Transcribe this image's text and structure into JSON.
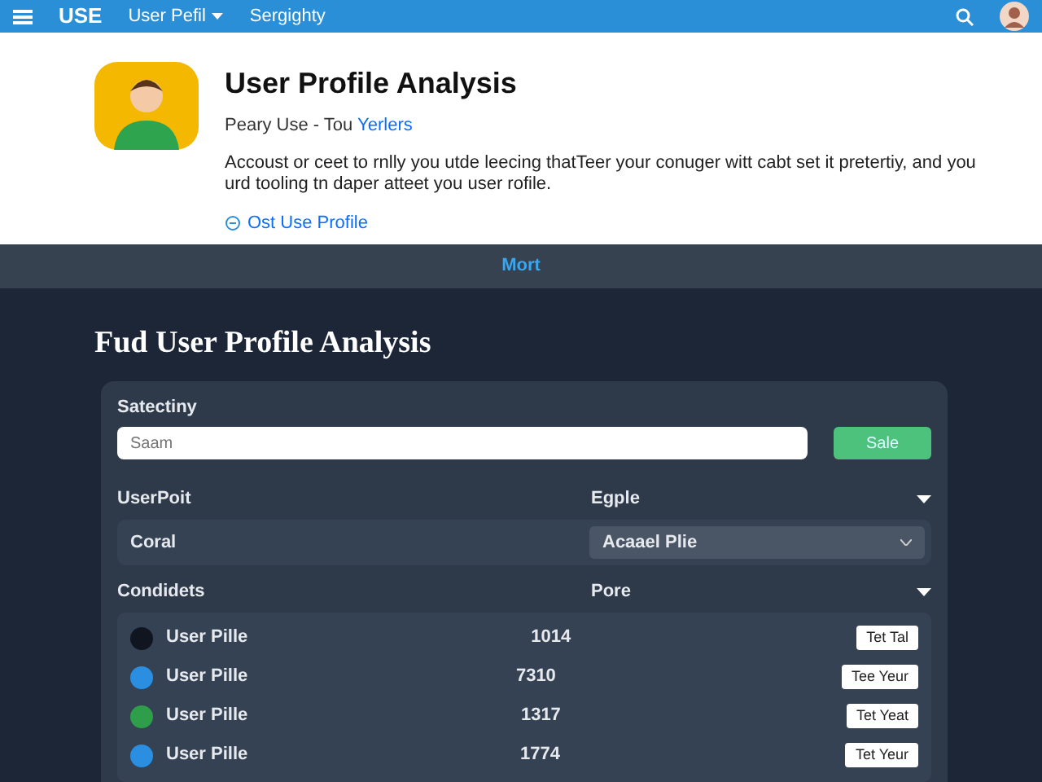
{
  "navbar": {
    "brand": "USE",
    "links": [
      {
        "label": "User Pefil",
        "dropdown": true
      },
      {
        "label": "Sergighty",
        "dropdown": false
      }
    ]
  },
  "profile": {
    "title": "User Profile Analysis",
    "subtitle": "Peary Use - Tou ",
    "subtitle_link": "Yerlers",
    "description": "Accoust or ceet to rnlly you utde leecing thatTeer your conuger witt cabt set it pretertiy, and you urd tooling tn daper atteet you user rofile.",
    "edit_link": "Ost Use Profile"
  },
  "more_bar": {
    "label": "Mort"
  },
  "section": {
    "title": "Fud User Profile Analysis",
    "search_label": "Satectiny",
    "search_placeholder": "Saam",
    "search_button": "Sale",
    "filter_headers": [
      "UserPoit",
      "Egple"
    ],
    "filter_value": "Coral",
    "filter_select": "Acaael Plie",
    "list_headers": [
      "Condidets",
      "Pore"
    ],
    "rows": [
      {
        "name": "User Pille",
        "color": "#10151f",
        "value": "1014",
        "action": "Tet Tal"
      },
      {
        "name": "User Pille",
        "color": "#2a8fe0",
        "value": "7310",
        "action": "Tee Yeur"
      },
      {
        "name": "User Pille",
        "color": "#2e9e4a",
        "value": "1317",
        "action": "Tet Yeat"
      },
      {
        "name": "User Pille",
        "color": "#2a8fe0",
        "value": "1774",
        "action": "Tet Yeur"
      }
    ]
  }
}
